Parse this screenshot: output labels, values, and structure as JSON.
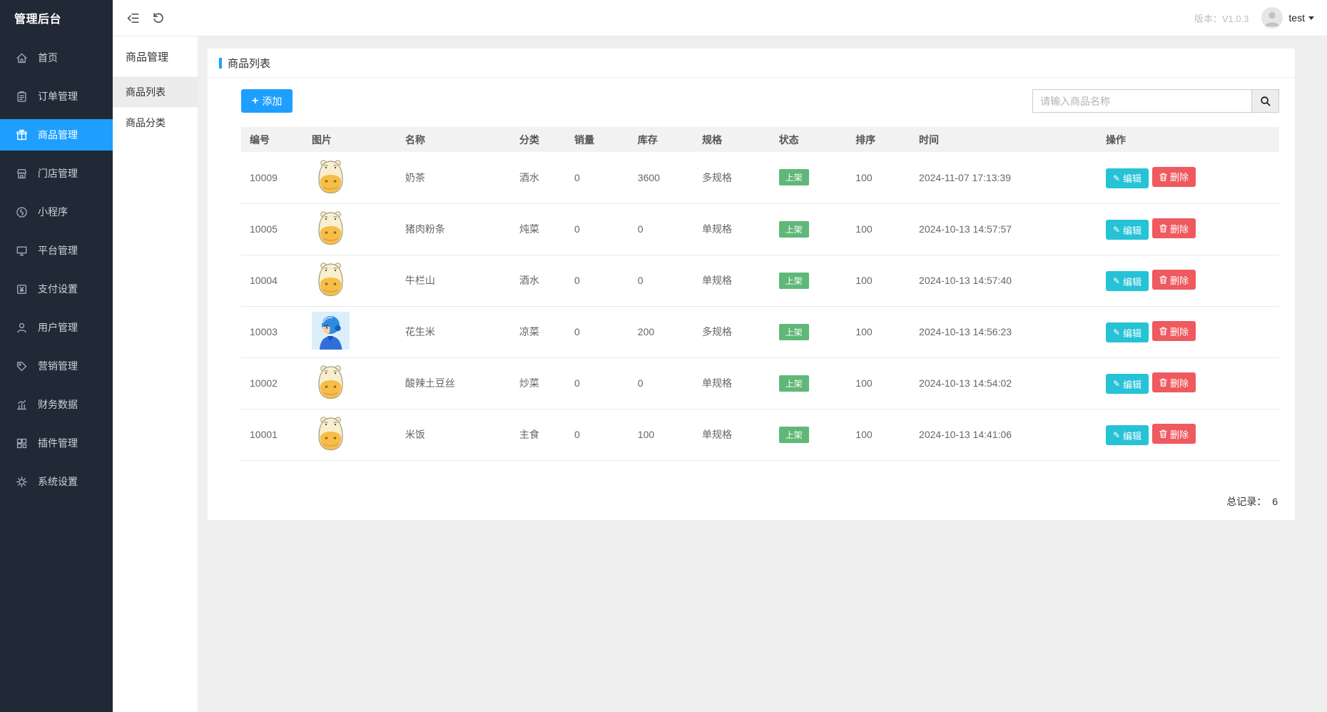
{
  "app": {
    "title": "管理后台",
    "version_label": "版本：V1.0.3",
    "user_name": "test"
  },
  "sidebar": {
    "items": [
      {
        "label": "首页",
        "icon": "home-icon",
        "active": false
      },
      {
        "label": "订单管理",
        "icon": "order-icon",
        "active": false
      },
      {
        "label": "商品管理",
        "icon": "product-icon",
        "active": true
      },
      {
        "label": "门店管理",
        "icon": "store-icon",
        "active": false
      },
      {
        "label": "小程序",
        "icon": "miniapp-icon",
        "active": false
      },
      {
        "label": "平台管理",
        "icon": "platform-icon",
        "active": false
      },
      {
        "label": "支付设置",
        "icon": "payment-icon",
        "active": false
      },
      {
        "label": "用户管理",
        "icon": "user-icon",
        "active": false
      },
      {
        "label": "营销管理",
        "icon": "marketing-icon",
        "active": false
      },
      {
        "label": "财务数据",
        "icon": "finance-icon",
        "active": false
      },
      {
        "label": "插件管理",
        "icon": "plugin-icon",
        "active": false
      },
      {
        "label": "系统设置",
        "icon": "settings-icon",
        "active": false
      }
    ]
  },
  "submenu": {
    "title": "商品管理",
    "items": [
      {
        "label": "商品列表",
        "active": true
      },
      {
        "label": "商品分类",
        "active": false
      }
    ]
  },
  "page": {
    "card_title": "商品列表",
    "add_button_label": "添加",
    "add_button_icon": "plus-icon",
    "search_placeholder": "请输入商品名称",
    "search_button_icon": "search-icon",
    "total_label": "总记录：",
    "total_value": "6"
  },
  "table": {
    "headers": [
      "编号",
      "图片",
      "名称",
      "分类",
      "销量",
      "库存",
      "规格",
      "状态",
      "排序",
      "时间",
      "操作"
    ],
    "actions": {
      "edit_label": "编辑",
      "edit_icon": "pencil-icon",
      "delete_label": "删除",
      "delete_icon": "trash-icon"
    },
    "rows": [
      {
        "id": "10009",
        "image": "hippo",
        "name": "奶茶",
        "category": "酒水",
        "sales": "0",
        "stock": "3600",
        "spec": "多规格",
        "spec_type": "multi",
        "status": "上架",
        "sort": "100",
        "time": "2024-11-07 17:13:39"
      },
      {
        "id": "10005",
        "image": "hippo",
        "name": "猪肉粉条",
        "category": "炖菜",
        "sales": "0",
        "stock": "0",
        "spec": "单规格",
        "spec_type": "single",
        "status": "上架",
        "sort": "100",
        "time": "2024-10-13 14:57:57"
      },
      {
        "id": "10004",
        "image": "hippo",
        "name": "牛栏山",
        "category": "酒水",
        "sales": "0",
        "stock": "0",
        "spec": "单规格",
        "spec_type": "single",
        "status": "上架",
        "sort": "100",
        "time": "2024-10-13 14:57:40"
      },
      {
        "id": "10003",
        "image": "rider",
        "name": "花生米",
        "category": "凉菜",
        "sales": "0",
        "stock": "200",
        "spec": "多规格",
        "spec_type": "multi",
        "status": "上架",
        "sort": "100",
        "time": "2024-10-13 14:56:23"
      },
      {
        "id": "10002",
        "image": "hippo",
        "name": "酸辣土豆丝",
        "category": "炒菜",
        "sales": "0",
        "stock": "0",
        "spec": "单规格",
        "spec_type": "single",
        "status": "上架",
        "sort": "100",
        "time": "2024-10-13 14:54:02"
      },
      {
        "id": "10001",
        "image": "hippo",
        "name": "米饭",
        "category": "主食",
        "sales": "0",
        "stock": "100",
        "spec": "单规格",
        "spec_type": "single",
        "status": "上架",
        "sort": "100",
        "time": "2024-10-13 14:41:06"
      }
    ]
  },
  "colors": {
    "accent_blue": "#1E9FFF",
    "sidebar_bg": "#212936",
    "badge_green": "#5FB878",
    "spec_red": "#e60000",
    "spec_green": "#4caf50",
    "edit_cyan": "#26c2d6",
    "delete_red": "#ee5a5f"
  }
}
